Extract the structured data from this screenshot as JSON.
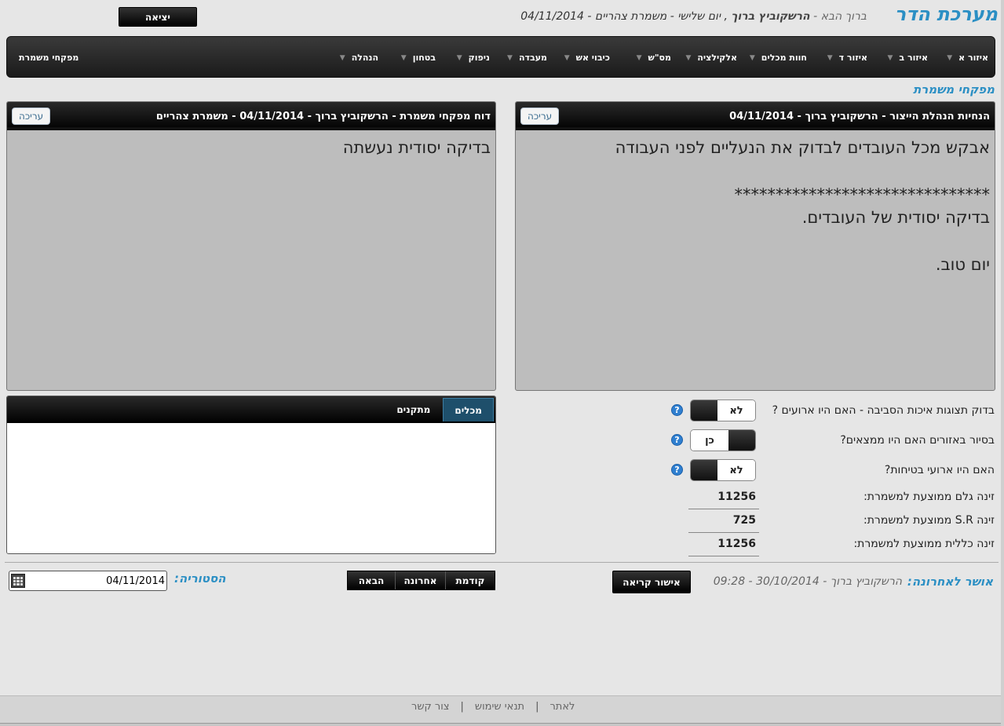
{
  "header": {
    "app_title": "מערכת הדר",
    "greeting_prefix": "ברוך הבא -",
    "user_name": "הרשקוביץ ברוך",
    "shift_info": ", יום שלישי - משמרת צהריים - 04/11/2014",
    "exit_label": "יציאה"
  },
  "nav": {
    "items": [
      {
        "label": "איזור א"
      },
      {
        "label": "איזור ב"
      },
      {
        "label": "איזור ד"
      },
      {
        "label": "חוות מכלים"
      },
      {
        "label": "אלקילציה"
      },
      {
        "label": "מס\"ש"
      },
      {
        "label": "כיבוי אש"
      },
      {
        "label": "מעבדה"
      },
      {
        "label": "ניפוק"
      },
      {
        "label": "בטחון"
      },
      {
        "label": "הנהלה"
      }
    ],
    "right_label": "מפקחי משמרת"
  },
  "section_title": "מפקחי משמרת",
  "left_panel": {
    "title": "הנחיות הנהלת הייצור - הרשקוביץ ברוך - 04/11/2014",
    "edit_label": "עריכה",
    "body": "אבקש מכל העובדים לבדוק את הנעליים לפני העבודה\n\n*******************************\nבדיקה יסודית של העובדים.\n\nיום טוב."
  },
  "right_panel": {
    "title": "דוח מפקחי משמרת - הרשקוביץ ברוך - 04/11/2014 - משמרת צהריים",
    "edit_label": "עריכה",
    "body": "בדיקה יסודית נעשתה"
  },
  "tabs": {
    "items": [
      {
        "label": "מכלים",
        "active": true
      },
      {
        "label": "מתקנים",
        "active": false
      }
    ]
  },
  "questions": [
    {
      "label": "בדוק תצוגות איכות הסביבה - האם היו ארועים ?",
      "value": "לא"
    },
    {
      "label": "בסיור באזורים האם היו ממצאים?",
      "value": "כן"
    },
    {
      "label": "האם היו ארועי בטיחות?",
      "value": "לא"
    }
  ],
  "stats": [
    {
      "label": "זינה גלם ממוצעת למשמרת:",
      "value": "11256"
    },
    {
      "label": "זינה S.R ממוצעת למשמרת:",
      "value": "725"
    },
    {
      "label": "זינה כללית ממוצעת למשמרת:",
      "value": "11256"
    }
  ],
  "bottom": {
    "last_approval_label": "אושר לאחרונה:",
    "last_approval_value": "הרשקוביץ ברוך - 30/10/2014 - 09:28",
    "approve_label": "אישור קריאה",
    "pager": {
      "prev": "קודמת",
      "last": "אחרונה",
      "next": "הבאה"
    },
    "history_label": "הסטוריה:",
    "date_value": "04/11/2014"
  },
  "footer": {
    "contact": "צור קשר",
    "terms": "תנאי שימוש",
    "site": "לאתר"
  },
  "colors": {
    "accent": "#2b8fc4",
    "bar": "#1b1b1b",
    "panel": "#bdbdbd",
    "active_tab": "#1e4f6b"
  }
}
